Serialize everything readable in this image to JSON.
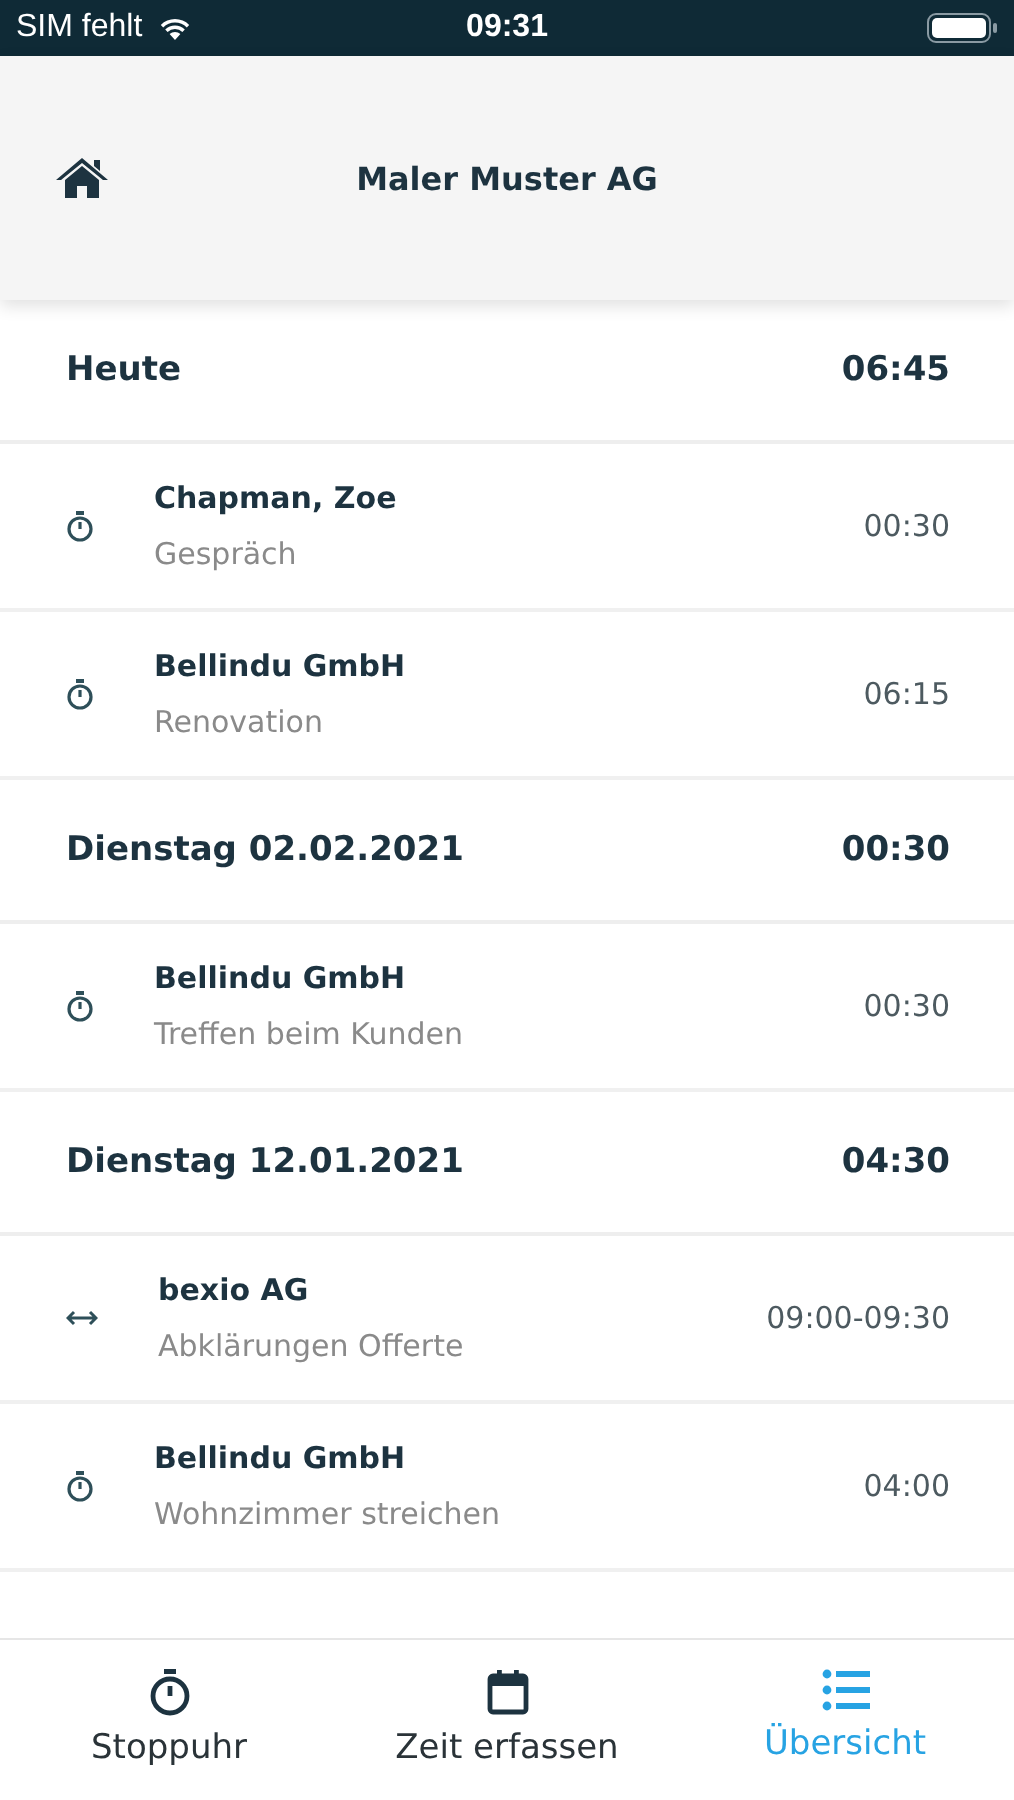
{
  "status_bar": {
    "carrier": "SIM fehlt",
    "time": "09:31"
  },
  "header": {
    "title": "Maler Muster AG"
  },
  "days": [
    {
      "label": "Heute",
      "total": "06:45",
      "entries": [
        {
          "kind": "stopwatch",
          "client": "Chapman, Zoe",
          "task": "Gespräch",
          "time": "00:30"
        },
        {
          "kind": "stopwatch",
          "client": "Bellindu GmbH",
          "task": "Renovation",
          "time": "06:15"
        }
      ]
    },
    {
      "label": "Dienstag 02.02.2021",
      "total": "00:30",
      "entries": [
        {
          "kind": "stopwatch",
          "client": "Bellindu GmbH",
          "task": "Treffen beim Kunden",
          "time": "00:30"
        }
      ]
    },
    {
      "label": "Dienstag 12.01.2021",
      "total": "04:30",
      "entries": [
        {
          "kind": "range",
          "client": "bexio AG",
          "task": "Abklärungen Offerte",
          "time": "09:00-09:30"
        },
        {
          "kind": "stopwatch",
          "client": "Bellindu GmbH",
          "task": "Wohnzimmer streichen",
          "time": "04:00"
        }
      ]
    }
  ],
  "tabs": [
    {
      "kind": "stopwatch",
      "label": "Stoppuhr",
      "selected": false
    },
    {
      "kind": "calendar",
      "label": "Zeit erfassen",
      "selected": false
    },
    {
      "kind": "list",
      "label": "Übersicht",
      "selected": true
    }
  ]
}
